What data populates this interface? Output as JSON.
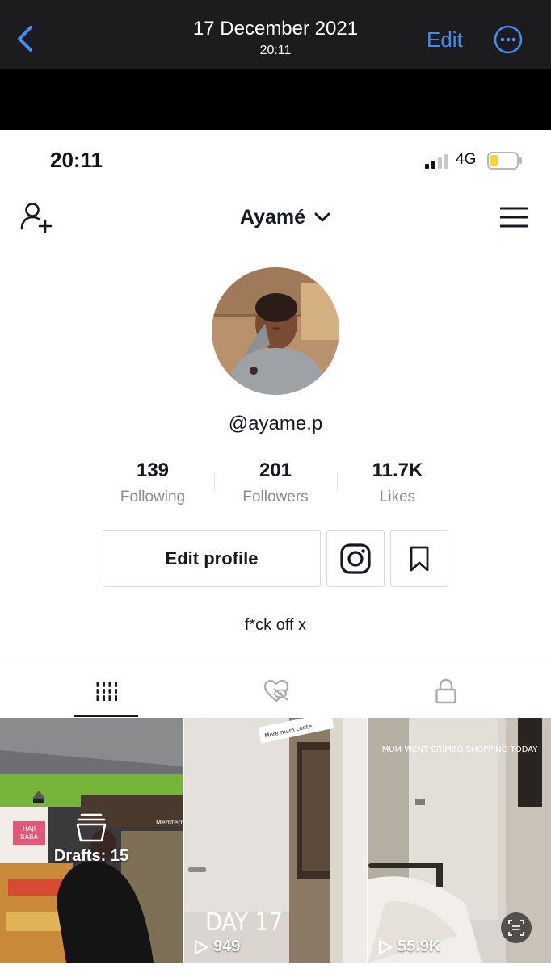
{
  "viewer": {
    "date": "17 December 2021",
    "time": "20:11",
    "edit_label": "Edit"
  },
  "status_bar": {
    "time": "20:11",
    "network": "4G"
  },
  "profile": {
    "username": "Ayamé",
    "handle": "@ayame.p",
    "stats": [
      {
        "value": "139",
        "label": "Following"
      },
      {
        "value": "201",
        "label": "Followers"
      },
      {
        "value": "11.7K",
        "label": "Likes"
      }
    ],
    "edit_profile_label": "Edit profile",
    "bio": "f*ck off x"
  },
  "tabs": [
    {
      "icon": "grid-icon",
      "active": true
    },
    {
      "icon": "liked-hidden-icon",
      "active": false
    },
    {
      "icon": "lock-icon",
      "active": false
    }
  ],
  "videos": [
    {
      "type": "drafts",
      "label": "Drafts: 15",
      "store_sign_1": "HAJI",
      "store_sign_2": "BABA",
      "aisle_sign": "Mediterrane"
    },
    {
      "type": "video",
      "views": "949",
      "overlay": "DAY 17",
      "sticker": "More mum conte"
    },
    {
      "type": "video",
      "views": "55.9K",
      "overlay": "MUM WENT CRIMBO SHOPPING TODAY"
    }
  ],
  "colors": {
    "accent_blue": "#3d8ef5",
    "battery_fill": "#f6d531",
    "text_primary": "#161823",
    "text_secondary": "#8a8b91"
  }
}
